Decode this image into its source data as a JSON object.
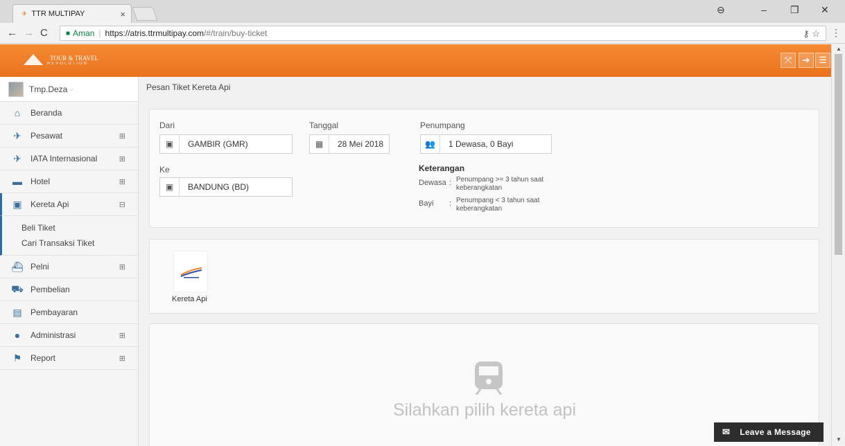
{
  "browser": {
    "tab_title": "TTR MULTIPAY",
    "secure_label": "Aman",
    "url_host": "https://atris.ttrmultipay.com",
    "url_path": "/#/train/buy-ticket"
  },
  "header": {
    "logo_text": "TOUR & TRAVEL",
    "logo_sub": "REVOLUTION"
  },
  "sidebar": {
    "user_name": "Tmp.Deza",
    "items": [
      {
        "label": "Beranda",
        "icon": "home-icon",
        "expand": ""
      },
      {
        "label": "Pesawat",
        "icon": "plane-icon",
        "expand": "⊞"
      },
      {
        "label": "IATA Internasional",
        "icon": "plane-icon",
        "expand": "⊞"
      },
      {
        "label": "Hotel",
        "icon": "bed-icon",
        "expand": "⊞"
      },
      {
        "label": "Kereta Api",
        "icon": "train-icon",
        "expand": "⊟"
      },
      {
        "label": "Pelni",
        "icon": "ship-icon",
        "expand": "⊞"
      },
      {
        "label": "Pembelian",
        "icon": "cart-icon",
        "expand": ""
      },
      {
        "label": "Pembayaran",
        "icon": "money-icon",
        "expand": ""
      },
      {
        "label": "Administrasi",
        "icon": "user-icon",
        "expand": "⊞"
      },
      {
        "label": "Report",
        "icon": "flag-icon",
        "expand": "⊞"
      }
    ],
    "sub_items": [
      "Beli Tiket",
      "Cari Transaksi Tiket"
    ]
  },
  "main": {
    "page_title": "Pesan Tiket Kereta Api",
    "form": {
      "from_label": "Dari",
      "from_value": "GAMBIR (GMR)",
      "to_label": "Ke",
      "to_value": "BANDUNG (BD)",
      "date_label": "Tanggal",
      "date_value": "28 Mei 2018",
      "pax_label": "Penumpang",
      "pax_value": "1 Dewasa, 0 Bayi"
    },
    "keterangan": {
      "title": "Keterangan",
      "adult_key": "Dewasa",
      "adult_val": "Penumpang >= 3 tahun saat keberangkatan",
      "infant_key": "Bayi",
      "infant_val": "Penumpang < 3 tahun saat keberangkatan"
    },
    "provider_label": "Kereta Api",
    "empty_text": "Silahkan pilih kereta api"
  },
  "chat": {
    "label": "Leave a Message"
  },
  "colors": {
    "accent": "#f58025",
    "nav_icon": "#3a6e9c",
    "active_border": "#2a6aa6"
  }
}
